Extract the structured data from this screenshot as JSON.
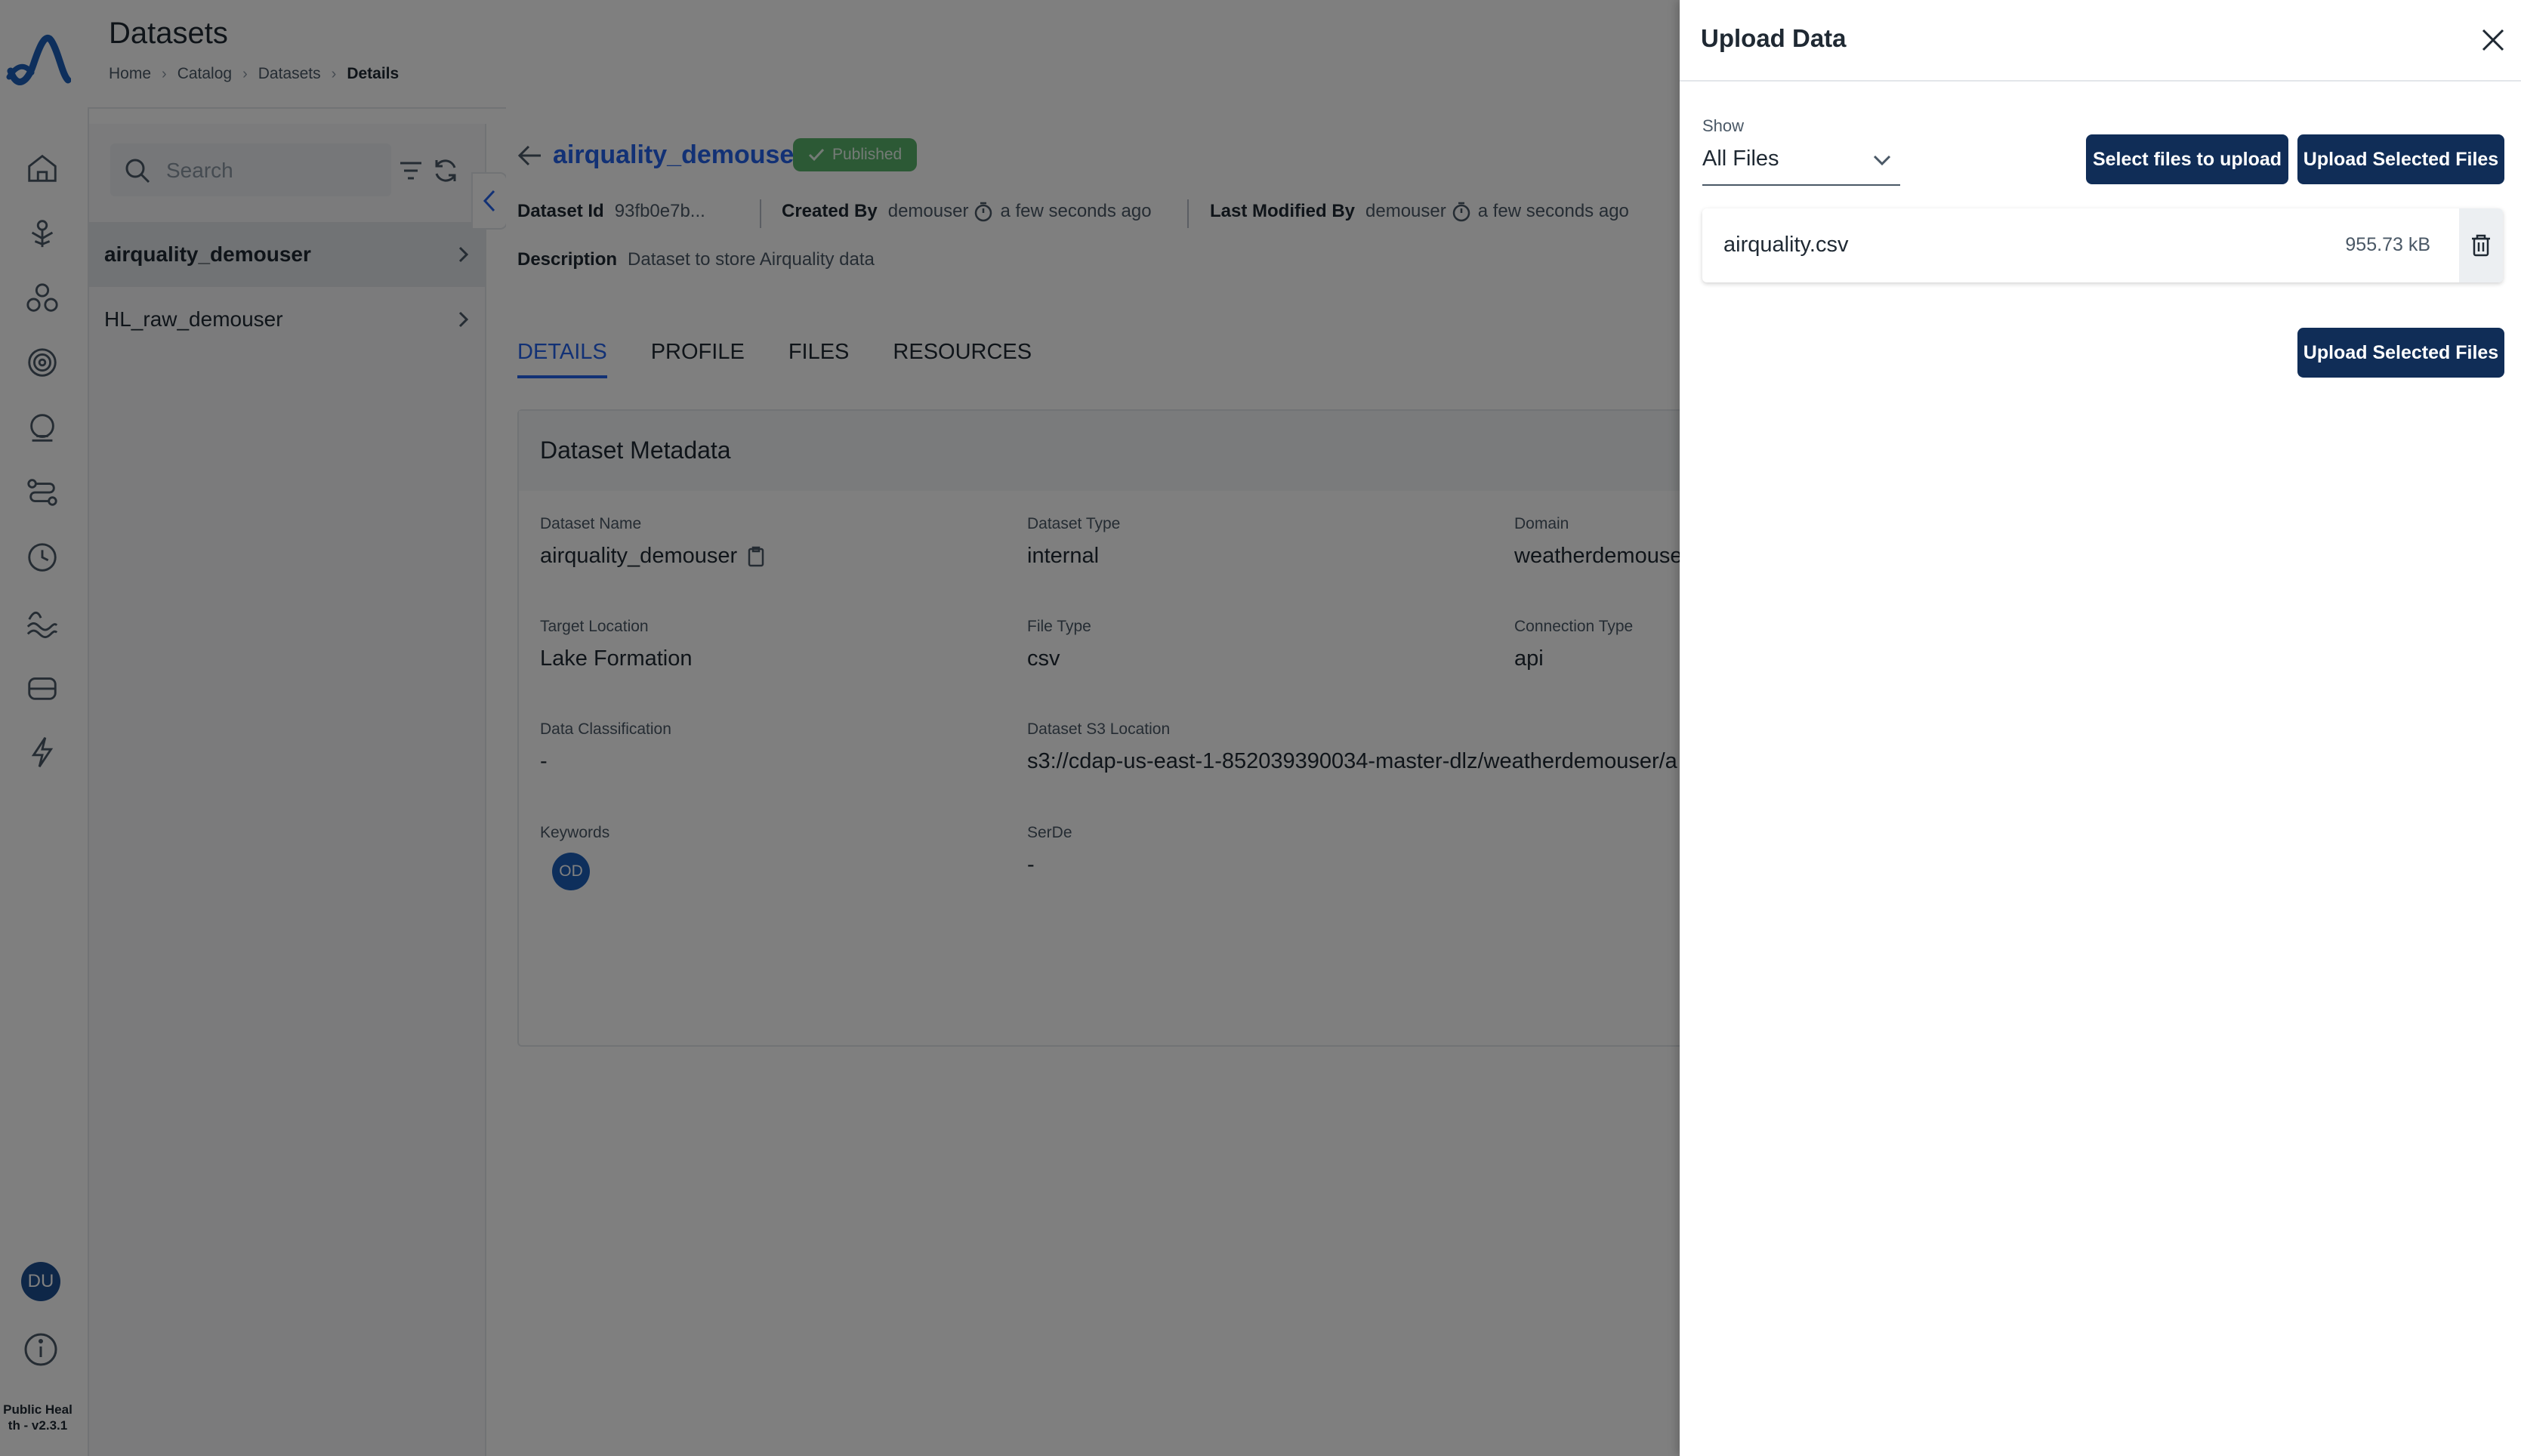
{
  "header": {
    "title": "Datasets",
    "breadcrumb": [
      "Home",
      "Catalog",
      "Datasets",
      "Details"
    ]
  },
  "rail": {
    "icons": [
      "home-icon",
      "tree-icon",
      "circles-icon",
      "target-icon",
      "dome-icon",
      "route-icon",
      "clock-icon",
      "waves-icon",
      "storage-icon",
      "lightning-icon"
    ],
    "avatar": "DU",
    "version": "Public Heal th - v2.3.1"
  },
  "list_panel": {
    "search_placeholder": "Search",
    "items": [
      {
        "label": "airquality_demouser",
        "active": true
      },
      {
        "label": "HL_raw_demouser",
        "active": false
      }
    ]
  },
  "dataset": {
    "name": "airquality_demouser",
    "status": "Published",
    "id_label": "Dataset Id",
    "id_value": "93fb0e7b...",
    "created_by_label": "Created By",
    "created_by": "demouser",
    "created_time": "a few seconds ago",
    "modified_by_label": "Last Modified By",
    "modified_by": "demouser",
    "modified_time": "a few seconds ago",
    "description_label": "Description",
    "description": "Dataset to store Airquality data"
  },
  "tabs": [
    "DETAILS",
    "PROFILE",
    "FILES",
    "RESOURCES"
  ],
  "metadata": {
    "title": "Dataset Metadata",
    "fields": {
      "dataset_name": {
        "label": "Dataset Name",
        "value": "airquality_demouser"
      },
      "dataset_type": {
        "label": "Dataset Type",
        "value": "internal"
      },
      "domain": {
        "label": "Domain",
        "value": "weatherdemouser"
      },
      "target_location": {
        "label": "Target Location",
        "value": "Lake Formation"
      },
      "file_type": {
        "label": "File Type",
        "value": "csv"
      },
      "connection_type": {
        "label": "Connection Type",
        "value": "api"
      },
      "data_classification": {
        "label": "Data Classification",
        "value": "-"
      },
      "s3_location": {
        "label": "Dataset S3 Location",
        "value": "s3://cdap-us-east-1-852039390034-master-dlz/weatherdemouser/a"
      },
      "keywords": {
        "label": "Keywords",
        "value": "OD"
      },
      "serde": {
        "label": "SerDe",
        "value": "-"
      }
    }
  },
  "drawer": {
    "title": "Upload Data",
    "show_label": "Show",
    "show_value": "All Files",
    "select_button": "Select files to upload",
    "upload_button": "Upload Selected Files",
    "upload_button_bottom": "Upload Selected Files",
    "files": [
      {
        "name": "airquality.csv",
        "size": "955.73 kB"
      }
    ]
  },
  "colors": {
    "accent": "#2563eb",
    "primary_button": "#102d57",
    "published_badge": "#59b36a",
    "overlay": "rgba(0,0,0,0.5)"
  }
}
